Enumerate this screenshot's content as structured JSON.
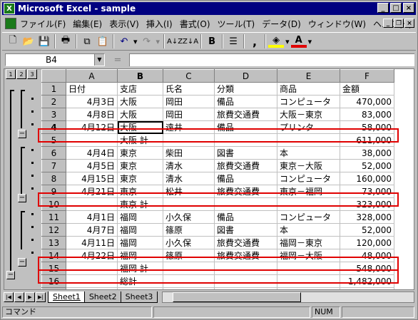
{
  "window": {
    "title": "Microsoft Excel - sample",
    "app_icon": "excel-icon"
  },
  "menu": {
    "items": [
      "ファイル(F)",
      "編集(E)",
      "表示(V)",
      "挿入(I)",
      "書式(O)",
      "ツール(T)",
      "データ(D)",
      "ウィンドウ(W)",
      "ヘルプ(H)"
    ]
  },
  "toolbar": {
    "comma_label": ","
  },
  "formula_bar": {
    "name_box": "B4",
    "eq_label": "=",
    "formula": ""
  },
  "outline": {
    "levels": [
      "1",
      "2",
      "3"
    ]
  },
  "columns": [
    "A",
    "B",
    "C",
    "D",
    "E",
    "F"
  ],
  "rows": [
    {
      "num": "1",
      "cells": [
        "日付",
        "支店",
        "氏名",
        "分類",
        "商品",
        "金額"
      ]
    },
    {
      "num": "2",
      "cells": [
        "4月3日",
        "大阪",
        "岡田",
        "備品",
        "コンピュータ",
        "470,000"
      ]
    },
    {
      "num": "3",
      "cells": [
        "4月8日",
        "大阪",
        "岡田",
        "旅費交通費",
        "大阪－東京",
        "83,000"
      ]
    },
    {
      "num": "4",
      "cells": [
        "4月12日",
        "大阪",
        "遠井",
        "備品",
        "プリンタ",
        "58,000"
      ]
    },
    {
      "num": "5",
      "cells": [
        "",
        "大阪 計",
        "",
        "",
        "",
        "611,000"
      ]
    },
    {
      "num": "6",
      "cells": [
        "4月4日",
        "東京",
        "柴田",
        "図書",
        "本",
        "38,000"
      ]
    },
    {
      "num": "7",
      "cells": [
        "4月5日",
        "東京",
        "清水",
        "旅費交通費",
        "東京－大阪",
        "52,000"
      ]
    },
    {
      "num": "8",
      "cells": [
        "4月15日",
        "東京",
        "清水",
        "備品",
        "コンピュータ",
        "160,000"
      ]
    },
    {
      "num": "9",
      "cells": [
        "4月21日",
        "東京",
        "松井",
        "旅費交通費",
        "東京－福岡",
        "73,000"
      ]
    },
    {
      "num": "10",
      "cells": [
        "",
        "東京 計",
        "",
        "",
        "",
        "323,000"
      ]
    },
    {
      "num": "11",
      "cells": [
        "4月1日",
        "福岡",
        "小久保",
        "備品",
        "コンピュータ",
        "328,000"
      ]
    },
    {
      "num": "12",
      "cells": [
        "4月7日",
        "福岡",
        "篠原",
        "図書",
        "本",
        "52,000"
      ]
    },
    {
      "num": "13",
      "cells": [
        "4月11日",
        "福岡",
        "小久保",
        "旅費交通費",
        "福岡－東京",
        "120,000"
      ]
    },
    {
      "num": "14",
      "cells": [
        "4月22日",
        "福岡",
        "篠原",
        "旅費交通費",
        "福岡－大阪",
        "48,000"
      ]
    },
    {
      "num": "15",
      "cells": [
        "",
        "福岡 計",
        "",
        "",
        "",
        "548,000"
      ]
    },
    {
      "num": "16",
      "cells": [
        "",
        "総計",
        "",
        "",
        "",
        "1,482,000"
      ]
    },
    {
      "num": "17",
      "cells": [
        "",
        "",
        "",
        "",
        "",
        ""
      ]
    }
  ],
  "sheet_tabs": [
    "Sheet1",
    "Sheet2",
    "Sheet3"
  ],
  "status": {
    "mode": "コマンド",
    "num": "NUM"
  },
  "colors": {
    "title_bg": "#000080",
    "highlight_box": "#e00000"
  }
}
